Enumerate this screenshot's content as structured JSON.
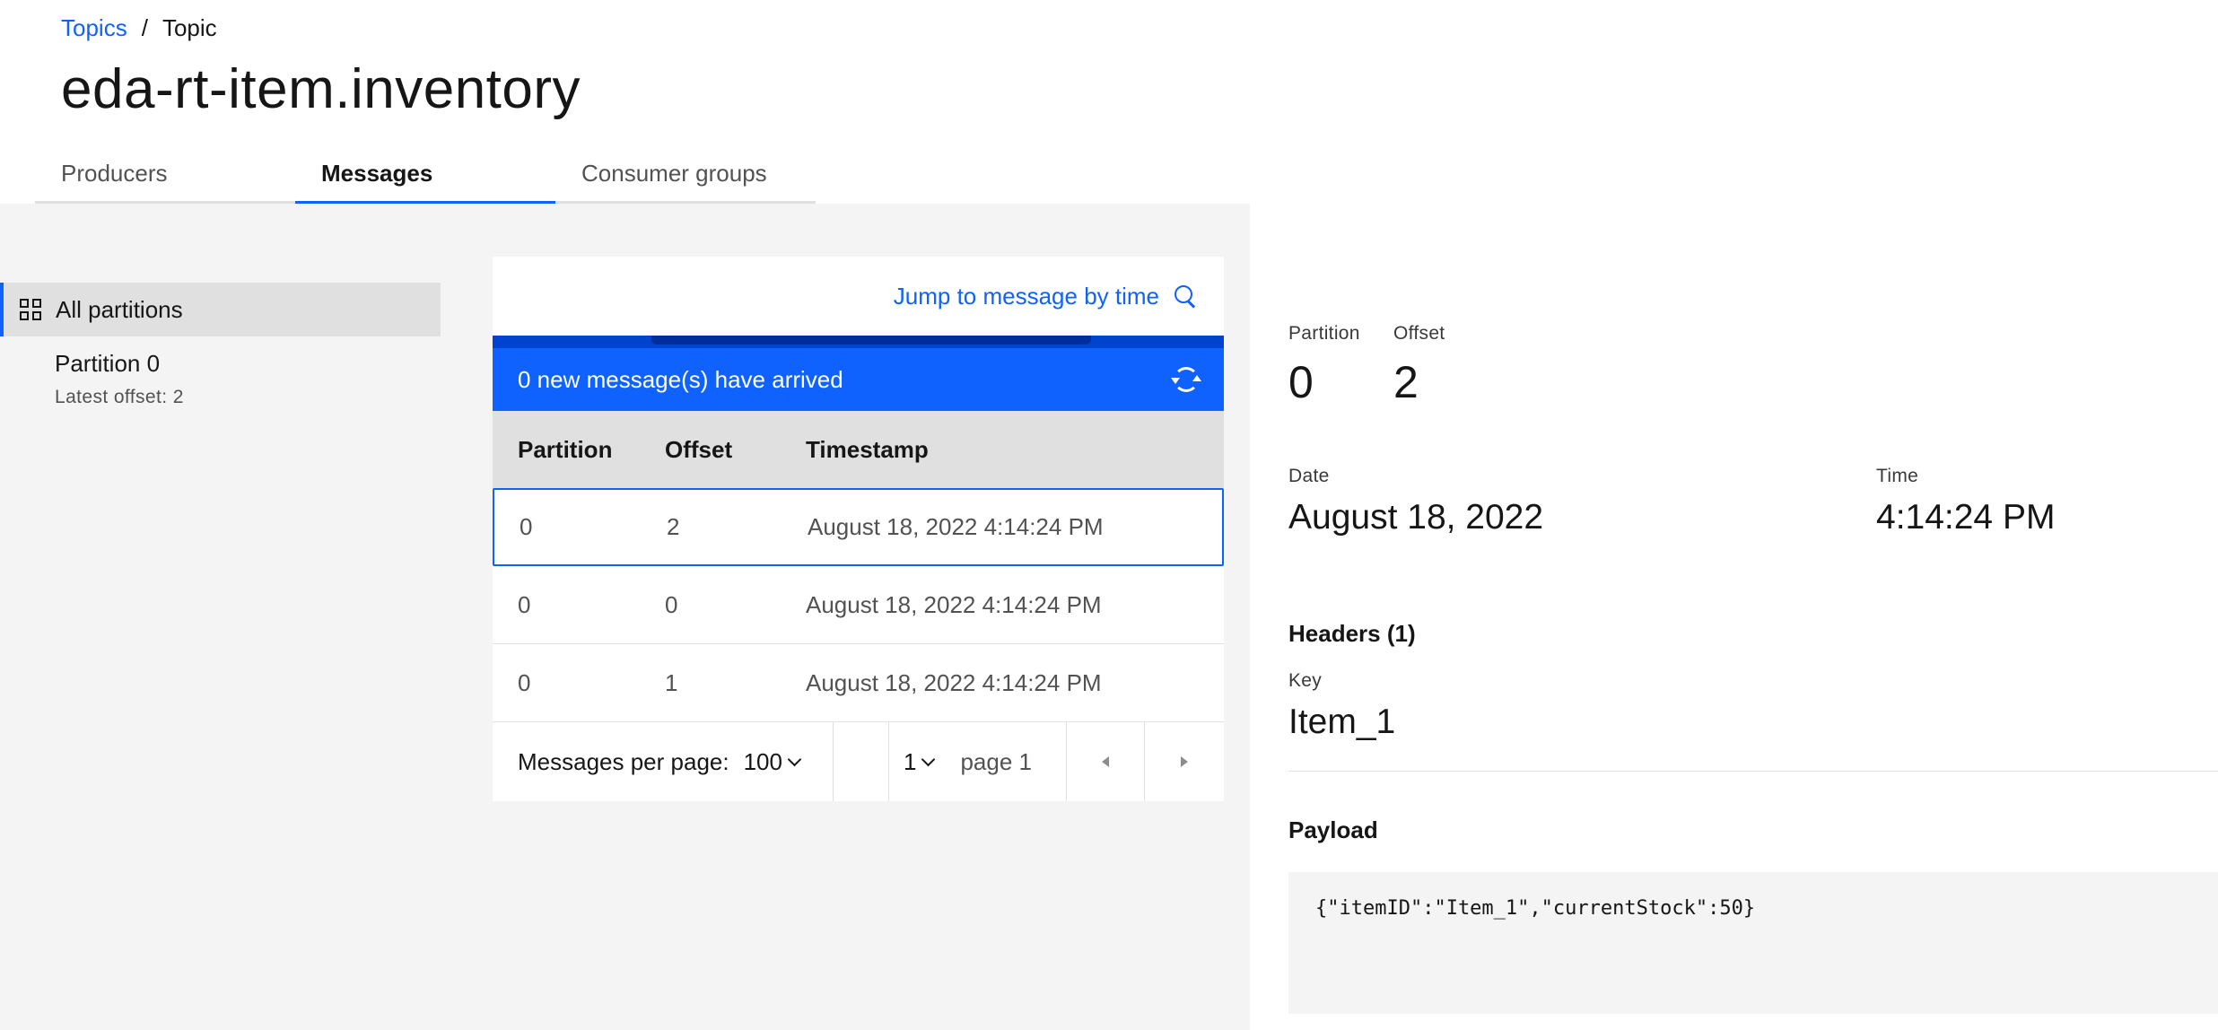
{
  "breadcrumb": {
    "parent": "Topics",
    "separator": "/",
    "current": "Topic"
  },
  "page_title": "eda-rt-item.inventory",
  "tabs": [
    {
      "label": "Producers",
      "active": false
    },
    {
      "label": "Messages",
      "active": true
    },
    {
      "label": "Consumer groups",
      "active": false
    }
  ],
  "partitions": {
    "all_label": "All partitions",
    "items": [
      {
        "label": "Partition 0",
        "sub": "Latest offset: 2"
      }
    ]
  },
  "messages": {
    "jump_label": "Jump to message by time",
    "notification": "0 new message(s) have arrived",
    "columns": [
      "Partition",
      "Offset",
      "Timestamp"
    ],
    "rows": [
      {
        "partition": "0",
        "offset": "2",
        "timestamp": "August 18, 2022 4:14:24 PM",
        "selected": true
      },
      {
        "partition": "0",
        "offset": "0",
        "timestamp": "August 18, 2022 4:14:24 PM",
        "selected": false
      },
      {
        "partition": "0",
        "offset": "1",
        "timestamp": "August 18, 2022 4:14:24 PM",
        "selected": false
      }
    ],
    "pagination": {
      "per_page_label": "Messages per page:",
      "per_page_value": "100",
      "page_select_value": "1",
      "page_label": "page 1"
    }
  },
  "details": {
    "partition_label": "Partition",
    "partition_value": "0",
    "offset_label": "Offset",
    "offset_value": "2",
    "date_label": "Date",
    "date_value": "August 18, 2022",
    "time_label": "Time",
    "time_value": "4:14:24 PM",
    "headers_heading": "Headers (1)",
    "key_label": "Key",
    "key_value": "Item_1",
    "payload_heading": "Payload",
    "payload_value": "{\"itemID\":\"Item_1\",\"currentStock\":50}"
  },
  "colors": {
    "accent": "#0f62fe",
    "body_bg": "#f4f4f4",
    "header_row": "#e0e0e0"
  }
}
